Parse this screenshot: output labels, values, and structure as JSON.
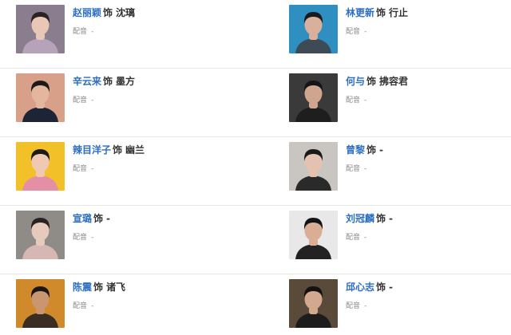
{
  "cast": [
    {
      "actor": "赵丽颖",
      "as": "饰",
      "role": "沈璃",
      "dub_label": "配音",
      "dub_value": "-",
      "bg": "#8a7d8e",
      "skin": "#e9c7b6",
      "hair": "#2c2424",
      "cloth": "#b6a2b9"
    },
    {
      "actor": "林更新",
      "as": "饰",
      "role": "行止",
      "dub_label": "配音",
      "dub_value": "-",
      "bg": "#2f8fc0",
      "skin": "#d8b09b",
      "hair": "#1a1a1a",
      "cloth": "#3e4b57"
    },
    {
      "actor": "辛云来",
      "as": "饰",
      "role": "墨方",
      "dub_label": "配音",
      "dub_value": "-",
      "bg": "#d9a089",
      "skin": "#e3b69d",
      "hair": "#1f1a1a",
      "cloth": "#1c2436"
    },
    {
      "actor": "何与",
      "as": "饰",
      "role": "拂容君",
      "dub_label": "配音",
      "dub_value": "-",
      "bg": "#3a3a3a",
      "skin": "#cfa58f",
      "hair": "#151515",
      "cloth": "#1e1e1e"
    },
    {
      "actor": "辣目洋子",
      "as": "饰",
      "role": "幽兰",
      "dub_label": "配音",
      "dub_value": "-",
      "bg": "#f2c028",
      "skin": "#f0c9b2",
      "hair": "#1d1a1a",
      "cloth": "#e58fa6"
    },
    {
      "actor": "曾黎",
      "as": "饰",
      "role": "-",
      "dub_label": "配音",
      "dub_value": "-",
      "bg": "#c9c6c2",
      "skin": "#e3c3b0",
      "hair": "#1a1a1a",
      "cloth": "#2a2a2a"
    },
    {
      "actor": "宣璐",
      "as": "饰",
      "role": "-",
      "dub_label": "配音",
      "dub_value": "-",
      "bg": "#8f8b86",
      "skin": "#e6cbbd",
      "hair": "#2a2222",
      "cloth": "#d6b7b3"
    },
    {
      "actor": "刘冠麟",
      "as": "饰",
      "role": "-",
      "dub_label": "配音",
      "dub_value": "-",
      "bg": "#e8e8e8",
      "skin": "#d9ae95",
      "hair": "#141414",
      "cloth": "#222222"
    },
    {
      "actor": "陈震",
      "as": "饰",
      "role": "诸飞",
      "dub_label": "配音",
      "dub_value": "-",
      "bg": "#d08a2c",
      "skin": "#c9966f",
      "hair": "#1b1513",
      "cloth": "#3a2e24"
    },
    {
      "actor": "邱心志",
      "as": "饰",
      "role": "-",
      "dub_label": "配音",
      "dub_value": "-",
      "bg": "#5a4a3a",
      "skin": "#d2a88e",
      "hair": "#121212",
      "cloth": "#1c1c1c"
    }
  ]
}
